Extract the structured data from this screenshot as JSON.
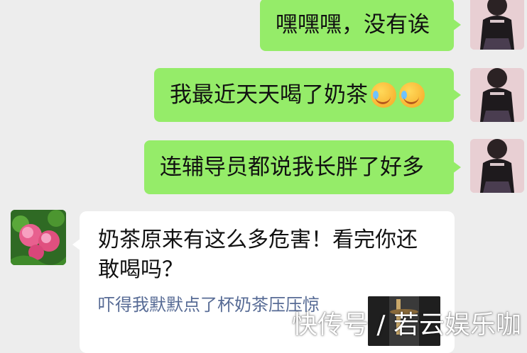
{
  "messages": {
    "outgoing": [
      {
        "text": "嘿嘿嘿，没有诶"
      },
      {
        "text": "我最近天天喝了奶茶"
      },
      {
        "text": "连辅导员都说我长胖了好多"
      }
    ],
    "emoji_name": "laughing-tears-emoji"
  },
  "shared_article": {
    "title": "奶茶原来有这么多危害！看完你还敢喝吗？",
    "subtitle": "吓得我默默点了杯奶茶压压惊"
  },
  "watermark": "快传号 / 若云娱乐咖",
  "colors": {
    "background": "#ededed",
    "bubble_green": "#95ec69",
    "link_blue": "#576b95"
  }
}
